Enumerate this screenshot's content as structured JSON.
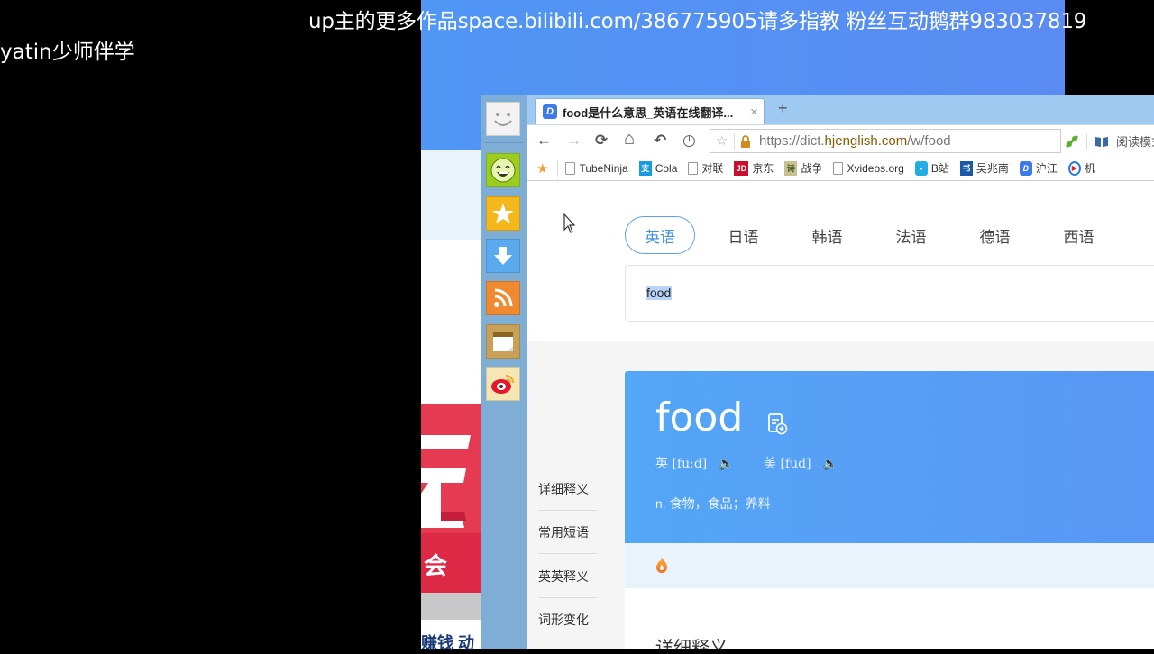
{
  "overlay": {
    "top_banner": "up主的更多作品space.bilibili.com/386775905请多指教  粉丝互动鹅群983037819",
    "left_caption": "yatin少师伴学"
  },
  "background_page": {
    "red_banner_text": "会",
    "bottom_text": "赚钱  动"
  },
  "dock": {
    "items": [
      {
        "name": "smiley-face-icon",
        "color": "#f0f0f0"
      },
      {
        "name": "laughing-emoji-icon",
        "color": "#9acd1e"
      },
      {
        "name": "favorites-star-icon",
        "color": "#f5b81c"
      },
      {
        "name": "download-arrow-icon",
        "color": "#5aaaf0"
      },
      {
        "name": "rss-feed-icon",
        "color": "#f08a30"
      },
      {
        "name": "sticky-note-icon",
        "color": "#c8a058"
      },
      {
        "name": "weibo-icon",
        "color": "#f5e6b4"
      }
    ]
  },
  "browser": {
    "tab": {
      "title": "food是什么意思_英语在线翻译...",
      "close": "×",
      "favicon": "D"
    },
    "new_tab": "+",
    "nav": {
      "back": "←",
      "forward": "→",
      "reload": "⟳",
      "home": "⌂",
      "undo": "↶",
      "history": "◷"
    },
    "url": {
      "prefix": "https://dict.",
      "domain": "hjenglish.com",
      "path": "/w/food"
    },
    "reading_mode": "阅读模式",
    "bookmarks": [
      {
        "label": "TubeNinja",
        "icon": "page-icon"
      },
      {
        "label": "Cola",
        "icon": "alipay-icon"
      },
      {
        "label": "对联",
        "icon": "page-icon"
      },
      {
        "label": "京东",
        "icon": "jd-icon"
      },
      {
        "label": "战争",
        "icon": "calligraphy-icon"
      },
      {
        "label": "Xvideos.org",
        "icon": "page-icon"
      },
      {
        "label": "B站",
        "icon": "bilibili-icon"
      },
      {
        "label": "吴兆南",
        "icon": "book-icon"
      },
      {
        "label": "沪江",
        "icon": "hujiang-icon"
      },
      {
        "label": "机",
        "icon": "play-icon"
      }
    ]
  },
  "dict": {
    "lang_tabs": [
      {
        "label": "英语",
        "active": true
      },
      {
        "label": "日语",
        "active": false
      },
      {
        "label": "韩语",
        "active": false
      },
      {
        "label": "法语",
        "active": false
      },
      {
        "label": "德语",
        "active": false
      },
      {
        "label": "西语",
        "active": false
      }
    ],
    "search_value": "food",
    "left_nav": [
      "详细释义",
      "常用短语",
      "英英释义",
      "词形变化"
    ],
    "word": "food",
    "pronunciations": [
      {
        "label": "英 [fuːd]"
      },
      {
        "label": "美 [fud]"
      }
    ],
    "definition": "n. 食物，食品；养料",
    "section_title": "详细释义",
    "colors": {
      "card_blue": "#54a6f6",
      "accent": "#3f93dc",
      "hot_strip": "#e9f3fc"
    }
  }
}
